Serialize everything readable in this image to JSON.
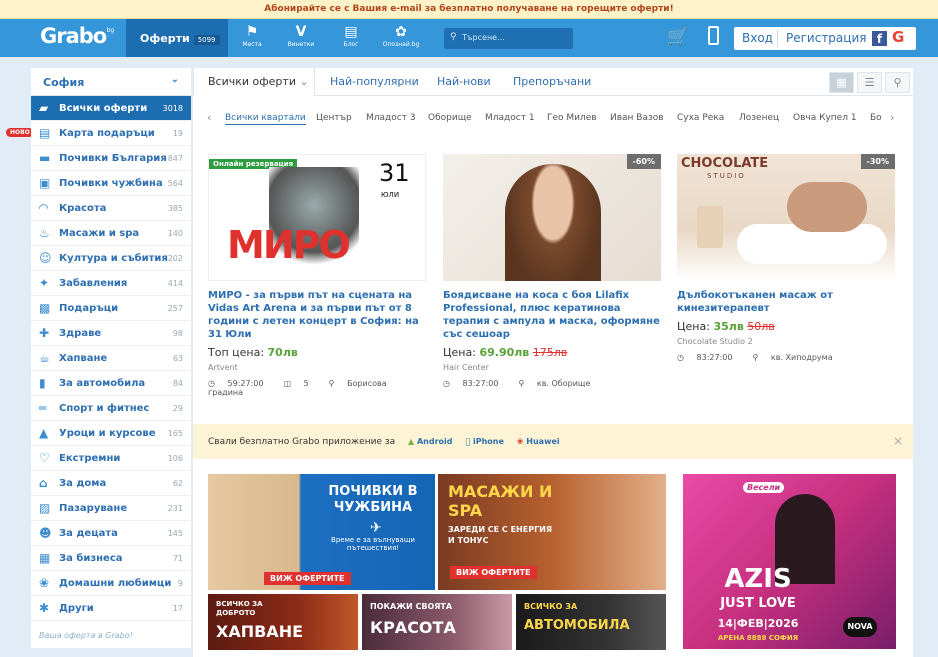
{
  "topbar": {
    "text": "Абонирайте се с Вашия e-mail за безплатно получаване на горещите оферти!"
  },
  "header": {
    "logo": "Grabo",
    "logo_tld": "bg",
    "offers_label": "Оферти",
    "offers_count": "5099",
    "nav": [
      {
        "label": "Места",
        "icon": "pin-icon"
      },
      {
        "label": "Винетки",
        "icon": "vignette-icon"
      },
      {
        "label": "Блог",
        "icon": "blog-icon"
      },
      {
        "label": "Опознай.bg",
        "icon": "dove-icon"
      }
    ],
    "search_placeholder": "Търсене...",
    "login": "Вход",
    "register": "Регистрация"
  },
  "sidebar": {
    "city": "София",
    "new_badge": "НОВО",
    "items": [
      {
        "label": "Всички оферти",
        "count": "3018",
        "icon": "tag-icon"
      },
      {
        "label": "Карта подаръци",
        "count": "19",
        "icon": "gift-card-icon"
      },
      {
        "label": "Почивки България",
        "count": "847",
        "icon": "bed-icon"
      },
      {
        "label": "Почивки чужбина",
        "count": "564",
        "icon": "luggage-icon"
      },
      {
        "label": "Красота",
        "count": "385",
        "icon": "lips-icon"
      },
      {
        "label": "Масажи и spa",
        "count": "140",
        "icon": "spa-icon"
      },
      {
        "label": "Култура и събития",
        "count": "202",
        "icon": "theater-icon"
      },
      {
        "label": "Забавления",
        "count": "414",
        "icon": "puzzle-icon"
      },
      {
        "label": "Подаръци",
        "count": "257",
        "icon": "present-icon"
      },
      {
        "label": "Здраве",
        "count": "98",
        "icon": "health-icon"
      },
      {
        "label": "Хапване",
        "count": "63",
        "icon": "food-icon"
      },
      {
        "label": "За автомобила",
        "count": "84",
        "icon": "car-icon"
      },
      {
        "label": "Спорт и фитнес",
        "count": "29",
        "icon": "dumbbell-icon"
      },
      {
        "label": "Уроци и курсове",
        "count": "165",
        "icon": "graduation-icon"
      },
      {
        "label": "Екстремни",
        "count": "106",
        "icon": "heartbeat-icon"
      },
      {
        "label": "За дома",
        "count": "62",
        "icon": "home-icon"
      },
      {
        "label": "Пазаруване",
        "count": "231",
        "icon": "basket-icon"
      },
      {
        "label": "За децата",
        "count": "145",
        "icon": "child-icon"
      },
      {
        "label": "За бизнеса",
        "count": "71",
        "icon": "business-icon"
      },
      {
        "label": "Домашни любимци",
        "count": "9",
        "icon": "paw-icon"
      },
      {
        "label": "Други",
        "count": "17",
        "icon": "asterisk-icon"
      }
    ],
    "promo": "Ваша оферта в Grabo!"
  },
  "main": {
    "tabs": [
      "Всички оферти",
      "Най-популярни",
      "Най-нови",
      "Препоръчани"
    ],
    "hoods": [
      "Всички квартали",
      "Център",
      "Младост 3",
      "Оборище",
      "Младост 1",
      "Гео Милев",
      "Иван Вазов",
      "Суха Река",
      "Лозенец",
      "Овча Купел 1",
      "Бо"
    ],
    "cards": [
      {
        "title": "МИРО - за първи път на сцената на Vidas Art Arena и за първи път от 8 години с летен концерт в София: на 31 Юли",
        "price_label": "Топ цена:",
        "price": "70лв",
        "old_price": "",
        "merchant": "Artvent",
        "time": "59:27:00",
        "count": "5",
        "location": "Борисова градина",
        "badge": "Онлайн резервация",
        "discount": "",
        "poster_name": "МИРО",
        "poster_date": "31",
        "poster_month": "ЮЛИ"
      },
      {
        "title": "Боядисване на коса с боя Lilafix Professional, плюс кератинова терапия с ампула и маска, оформяне със сешоар",
        "price_label": "Цена:",
        "price": "69.90лв",
        "old_price": "175лв",
        "merchant": "Hair Center",
        "time": "83:27:00",
        "count": "",
        "location": "кв. Оборище",
        "badge": "",
        "discount": "-60%"
      },
      {
        "title": "Дълбокотъканен масаж от кинезитерапевт",
        "price_label": "Цена:",
        "price": "35лв",
        "old_price": "50лв",
        "merchant": "Chocolate Studio 2",
        "time": "83:27:00",
        "count": "",
        "location": "кв. Хиподрума",
        "badge": "",
        "discount": "-30%",
        "logo": "CHOCOLATE",
        "logo_sub": "STUDIO"
      }
    ],
    "app": {
      "text": "Свали безплатно Grabo приложение за",
      "android": "Android",
      "iphone": "iPhone",
      "huawei": "Huawei"
    },
    "banners": {
      "travel_title": "ПОЧИВКИ В ЧУЖБИНА",
      "travel_sub": "Време е за вълнуващи пътешествия!",
      "travel_cta": "ВИЖ ОФЕРТИТЕ",
      "spa_title": "МАСАЖИ И SPA",
      "spa_sub": "ЗАРЕДИ СЕ С ЕНЕРГИЯ И ТОНУС",
      "spa_cta": "ВИЖ ОФЕРТИТЕ",
      "food_top": "ВСИЧКО ЗА ДОБРОТО",
      "food_title": "ХАПВАНЕ",
      "beauty_top": "ПОКАЖИ СВОЯТА",
      "beauty_title": "КРАСОТА",
      "auto_top": "ВСИЧКО ЗА",
      "auto_title": "АВТОМОБИЛА",
      "azis_title": "AZIS",
      "azis_sub": "JUST LOVE",
      "azis_date": "14|ФЕВ|2026",
      "azis_venue": "АРЕНА 8888 СОФИЯ",
      "azis_logo": "Весели",
      "azis_tv": "NOVA"
    }
  }
}
